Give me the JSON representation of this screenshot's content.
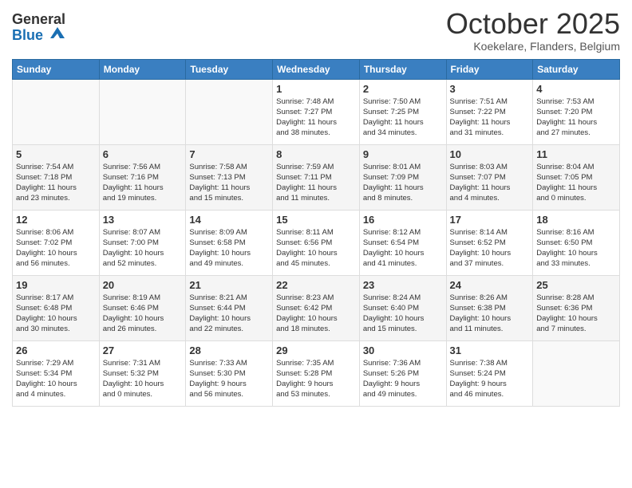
{
  "header": {
    "logo_line1": "General",
    "logo_line2": "Blue",
    "month": "October 2025",
    "location": "Koekelare, Flanders, Belgium"
  },
  "weekdays": [
    "Sunday",
    "Monday",
    "Tuesday",
    "Wednesday",
    "Thursday",
    "Friday",
    "Saturday"
  ],
  "weeks": [
    [
      {
        "day": "",
        "info": ""
      },
      {
        "day": "",
        "info": ""
      },
      {
        "day": "",
        "info": ""
      },
      {
        "day": "1",
        "info": "Sunrise: 7:48 AM\nSunset: 7:27 PM\nDaylight: 11 hours\nand 38 minutes."
      },
      {
        "day": "2",
        "info": "Sunrise: 7:50 AM\nSunset: 7:25 PM\nDaylight: 11 hours\nand 34 minutes."
      },
      {
        "day": "3",
        "info": "Sunrise: 7:51 AM\nSunset: 7:22 PM\nDaylight: 11 hours\nand 31 minutes."
      },
      {
        "day": "4",
        "info": "Sunrise: 7:53 AM\nSunset: 7:20 PM\nDaylight: 11 hours\nand 27 minutes."
      }
    ],
    [
      {
        "day": "5",
        "info": "Sunrise: 7:54 AM\nSunset: 7:18 PM\nDaylight: 11 hours\nand 23 minutes."
      },
      {
        "day": "6",
        "info": "Sunrise: 7:56 AM\nSunset: 7:16 PM\nDaylight: 11 hours\nand 19 minutes."
      },
      {
        "day": "7",
        "info": "Sunrise: 7:58 AM\nSunset: 7:13 PM\nDaylight: 11 hours\nand 15 minutes."
      },
      {
        "day": "8",
        "info": "Sunrise: 7:59 AM\nSunset: 7:11 PM\nDaylight: 11 hours\nand 11 minutes."
      },
      {
        "day": "9",
        "info": "Sunrise: 8:01 AM\nSunset: 7:09 PM\nDaylight: 11 hours\nand 8 minutes."
      },
      {
        "day": "10",
        "info": "Sunrise: 8:03 AM\nSunset: 7:07 PM\nDaylight: 11 hours\nand 4 minutes."
      },
      {
        "day": "11",
        "info": "Sunrise: 8:04 AM\nSunset: 7:05 PM\nDaylight: 11 hours\nand 0 minutes."
      }
    ],
    [
      {
        "day": "12",
        "info": "Sunrise: 8:06 AM\nSunset: 7:02 PM\nDaylight: 10 hours\nand 56 minutes."
      },
      {
        "day": "13",
        "info": "Sunrise: 8:07 AM\nSunset: 7:00 PM\nDaylight: 10 hours\nand 52 minutes."
      },
      {
        "day": "14",
        "info": "Sunrise: 8:09 AM\nSunset: 6:58 PM\nDaylight: 10 hours\nand 49 minutes."
      },
      {
        "day": "15",
        "info": "Sunrise: 8:11 AM\nSunset: 6:56 PM\nDaylight: 10 hours\nand 45 minutes."
      },
      {
        "day": "16",
        "info": "Sunrise: 8:12 AM\nSunset: 6:54 PM\nDaylight: 10 hours\nand 41 minutes."
      },
      {
        "day": "17",
        "info": "Sunrise: 8:14 AM\nSunset: 6:52 PM\nDaylight: 10 hours\nand 37 minutes."
      },
      {
        "day": "18",
        "info": "Sunrise: 8:16 AM\nSunset: 6:50 PM\nDaylight: 10 hours\nand 33 minutes."
      }
    ],
    [
      {
        "day": "19",
        "info": "Sunrise: 8:17 AM\nSunset: 6:48 PM\nDaylight: 10 hours\nand 30 minutes."
      },
      {
        "day": "20",
        "info": "Sunrise: 8:19 AM\nSunset: 6:46 PM\nDaylight: 10 hours\nand 26 minutes."
      },
      {
        "day": "21",
        "info": "Sunrise: 8:21 AM\nSunset: 6:44 PM\nDaylight: 10 hours\nand 22 minutes."
      },
      {
        "day": "22",
        "info": "Sunrise: 8:23 AM\nSunset: 6:42 PM\nDaylight: 10 hours\nand 18 minutes."
      },
      {
        "day": "23",
        "info": "Sunrise: 8:24 AM\nSunset: 6:40 PM\nDaylight: 10 hours\nand 15 minutes."
      },
      {
        "day": "24",
        "info": "Sunrise: 8:26 AM\nSunset: 6:38 PM\nDaylight: 10 hours\nand 11 minutes."
      },
      {
        "day": "25",
        "info": "Sunrise: 8:28 AM\nSunset: 6:36 PM\nDaylight: 10 hours\nand 7 minutes."
      }
    ],
    [
      {
        "day": "26",
        "info": "Sunrise: 7:29 AM\nSunset: 5:34 PM\nDaylight: 10 hours\nand 4 minutes."
      },
      {
        "day": "27",
        "info": "Sunrise: 7:31 AM\nSunset: 5:32 PM\nDaylight: 10 hours\nand 0 minutes."
      },
      {
        "day": "28",
        "info": "Sunrise: 7:33 AM\nSunset: 5:30 PM\nDaylight: 9 hours\nand 56 minutes."
      },
      {
        "day": "29",
        "info": "Sunrise: 7:35 AM\nSunset: 5:28 PM\nDaylight: 9 hours\nand 53 minutes."
      },
      {
        "day": "30",
        "info": "Sunrise: 7:36 AM\nSunset: 5:26 PM\nDaylight: 9 hours\nand 49 minutes."
      },
      {
        "day": "31",
        "info": "Sunrise: 7:38 AM\nSunset: 5:24 PM\nDaylight: 9 hours\nand 46 minutes."
      },
      {
        "day": "",
        "info": ""
      }
    ]
  ]
}
